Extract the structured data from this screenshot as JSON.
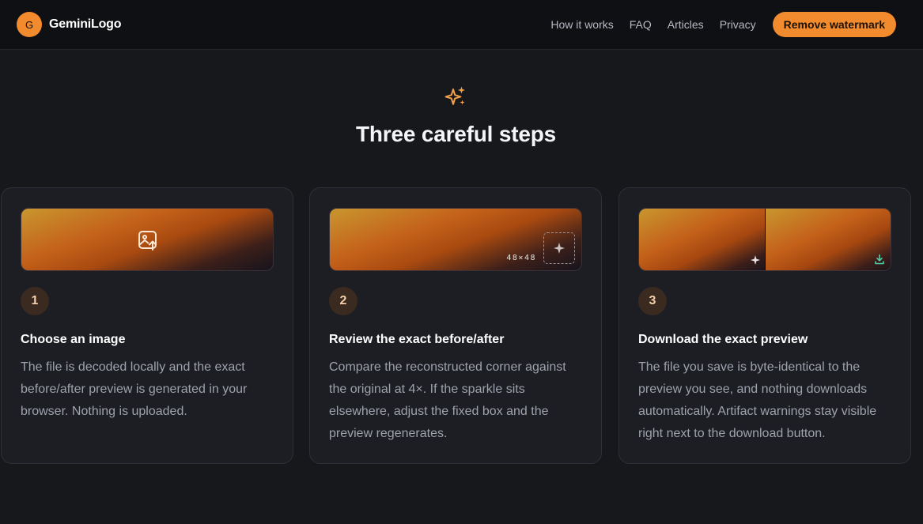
{
  "brand": {
    "mark": "G",
    "name": "GeminiLogo"
  },
  "nav": {
    "links": [
      "How it works",
      "FAQ",
      "Articles",
      "Privacy"
    ],
    "cta": "Remove watermark"
  },
  "section": {
    "icon": "sparkles-icon",
    "title": "Three careful steps"
  },
  "steps": [
    {
      "number": "1",
      "title": "Choose an image",
      "body": "The file is decoded locally and the exact before/after preview is generated in your browser. Nothing is uploaded.",
      "preview_icon": "image-upload-icon"
    },
    {
      "number": "2",
      "title": "Review the exact before/after",
      "body": "Compare the reconstructed corner against the original at 4×. If the sparkle sits elsewhere, adjust the fixed box and the preview regenerates.",
      "preview_label": "48×48",
      "preview_icon": "sparkle-icon"
    },
    {
      "number": "3",
      "title": "Download the exact preview",
      "body": "The file you save is byte-identical to the preview you see, and nothing downloads automatically. Artifact warnings stay visible right next to the download button.",
      "preview_icons": [
        "sparkle-icon",
        "download-icon"
      ]
    }
  ],
  "colors": {
    "accent": "#f28a2e",
    "background": "#17181c",
    "card": "#1d1e23",
    "download_icon": "#4fd1a5"
  }
}
